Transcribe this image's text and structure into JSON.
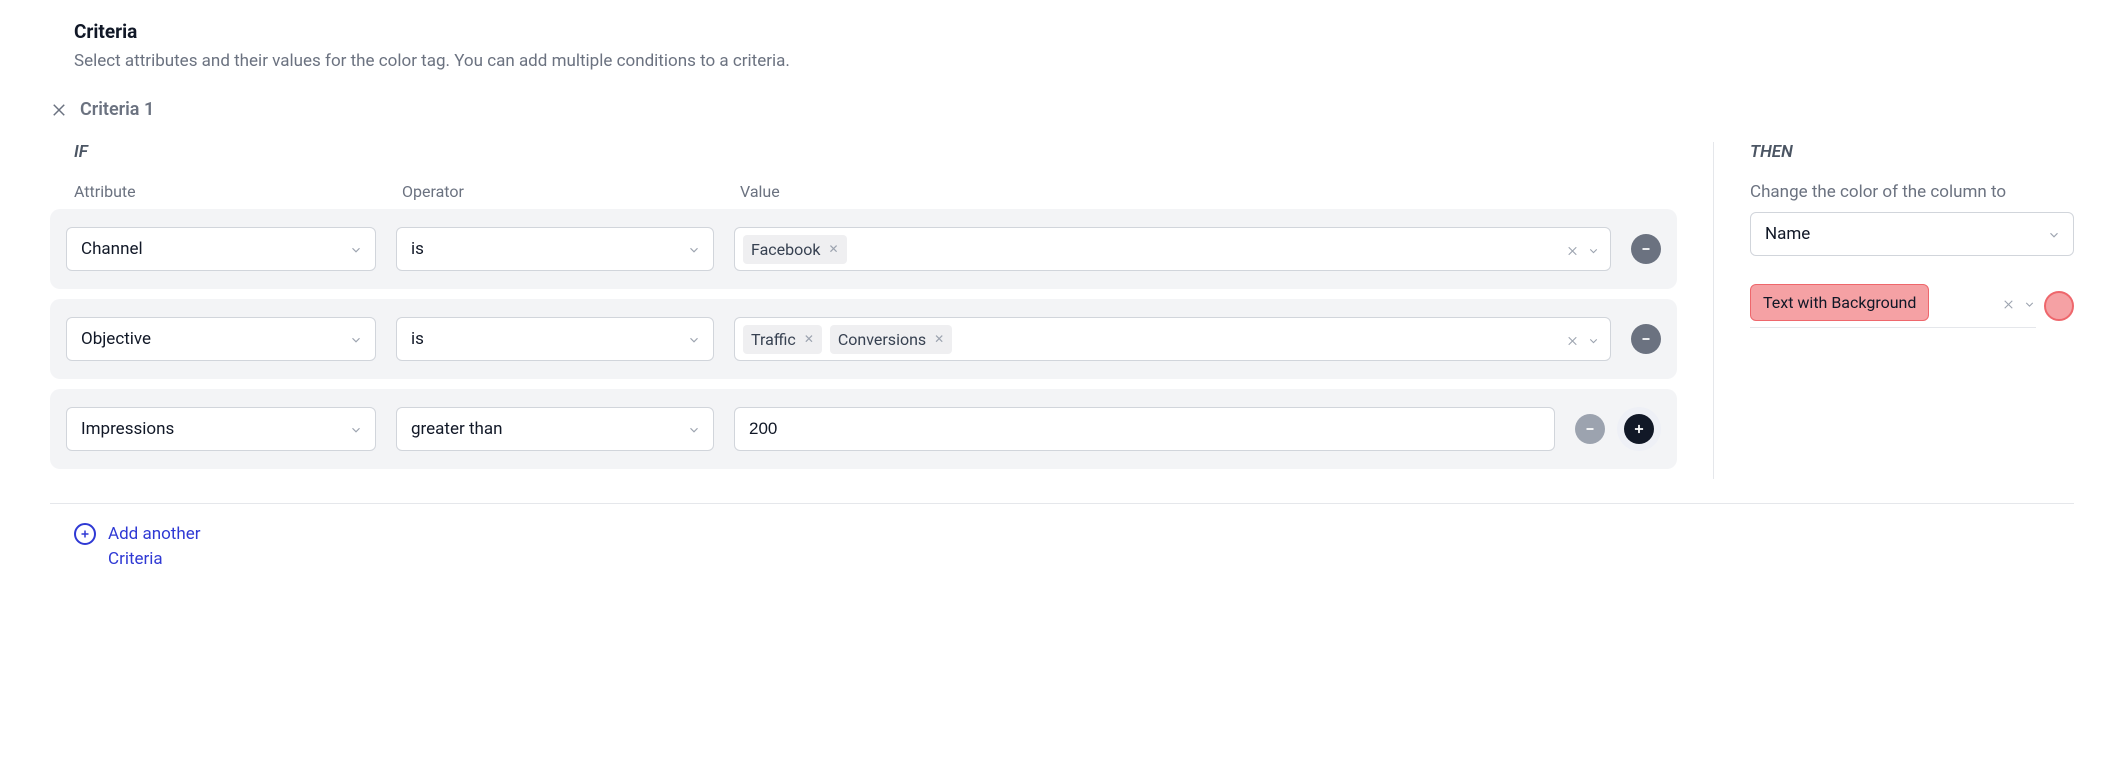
{
  "header": {
    "title": "Criteria",
    "description": "Select attributes and their values for the color tag. You can add multiple conditions to a criteria."
  },
  "criteria": {
    "name": "Criteria 1",
    "if_label": "IF",
    "columns": {
      "attribute": "Attribute",
      "operator": "Operator",
      "value": "Value"
    },
    "conditions": [
      {
        "attribute": "Channel",
        "operator": "is",
        "tags": [
          "Facebook"
        ]
      },
      {
        "attribute": "Objective",
        "operator": "is",
        "tags": [
          "Traffic",
          "Conversions"
        ]
      },
      {
        "attribute": "Impressions",
        "operator": "greater than",
        "value": "200"
      }
    ]
  },
  "then": {
    "label": "THEN",
    "description": "Change the color of the column to",
    "column": "Name",
    "style_label": "Text with Background",
    "color": "#f5a1a4"
  },
  "add_link": "Add another Criteria"
}
